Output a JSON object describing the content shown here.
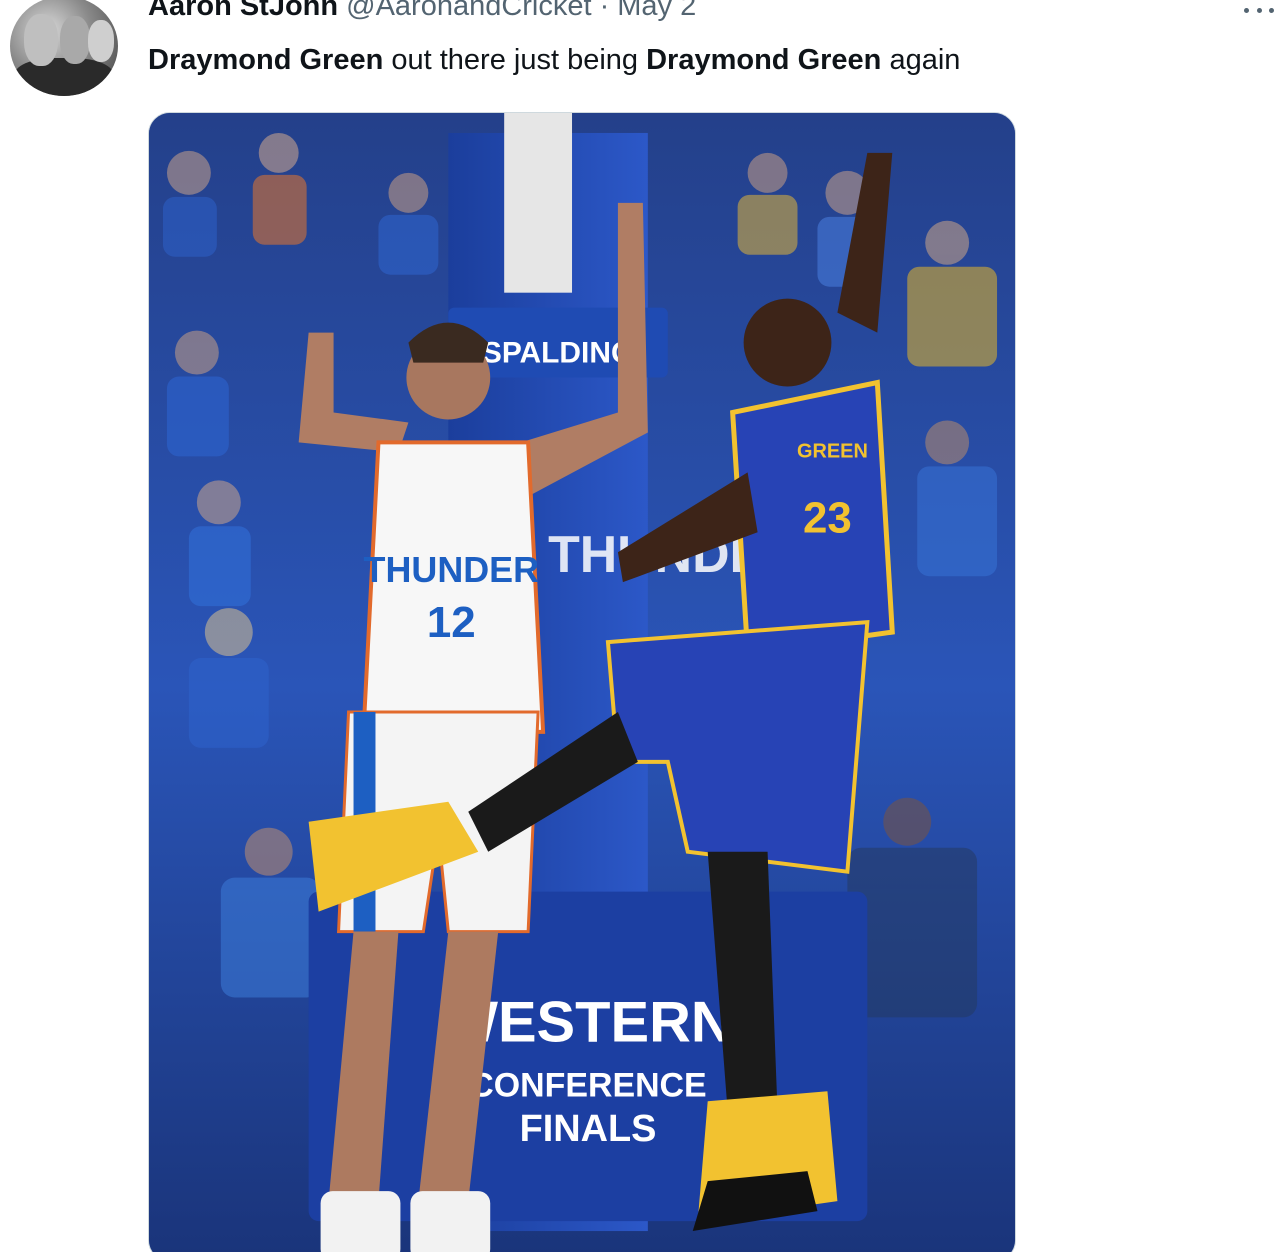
{
  "tweet": {
    "author": {
      "display_name": "Aaron StJohn",
      "handle": "@AaronandCricket",
      "separator": "·",
      "date": "May 2"
    },
    "text": {
      "part1": "Draymond Green",
      "part2": " out there just being ",
      "part3": "Draymond Green",
      "part4": " again"
    },
    "media": {
      "backboard_brand": "SPALDING",
      "banner_team": "THUNDER",
      "banner_line1": "WESTERN",
      "banner_line2": "CONFERENCE",
      "banner_line3": "FINALS",
      "player1_team": "THUNDER",
      "player1_number": "12",
      "player2_name": "GREEN",
      "player2_number": "23"
    },
    "icons": {
      "more": "more-horizontal-icon"
    },
    "colors": {
      "thunder_blue": "#1d5fc2",
      "warriors_blue": "#2743b5",
      "warriors_gold": "#f2c230",
      "secondary_text": "#536471"
    }
  }
}
